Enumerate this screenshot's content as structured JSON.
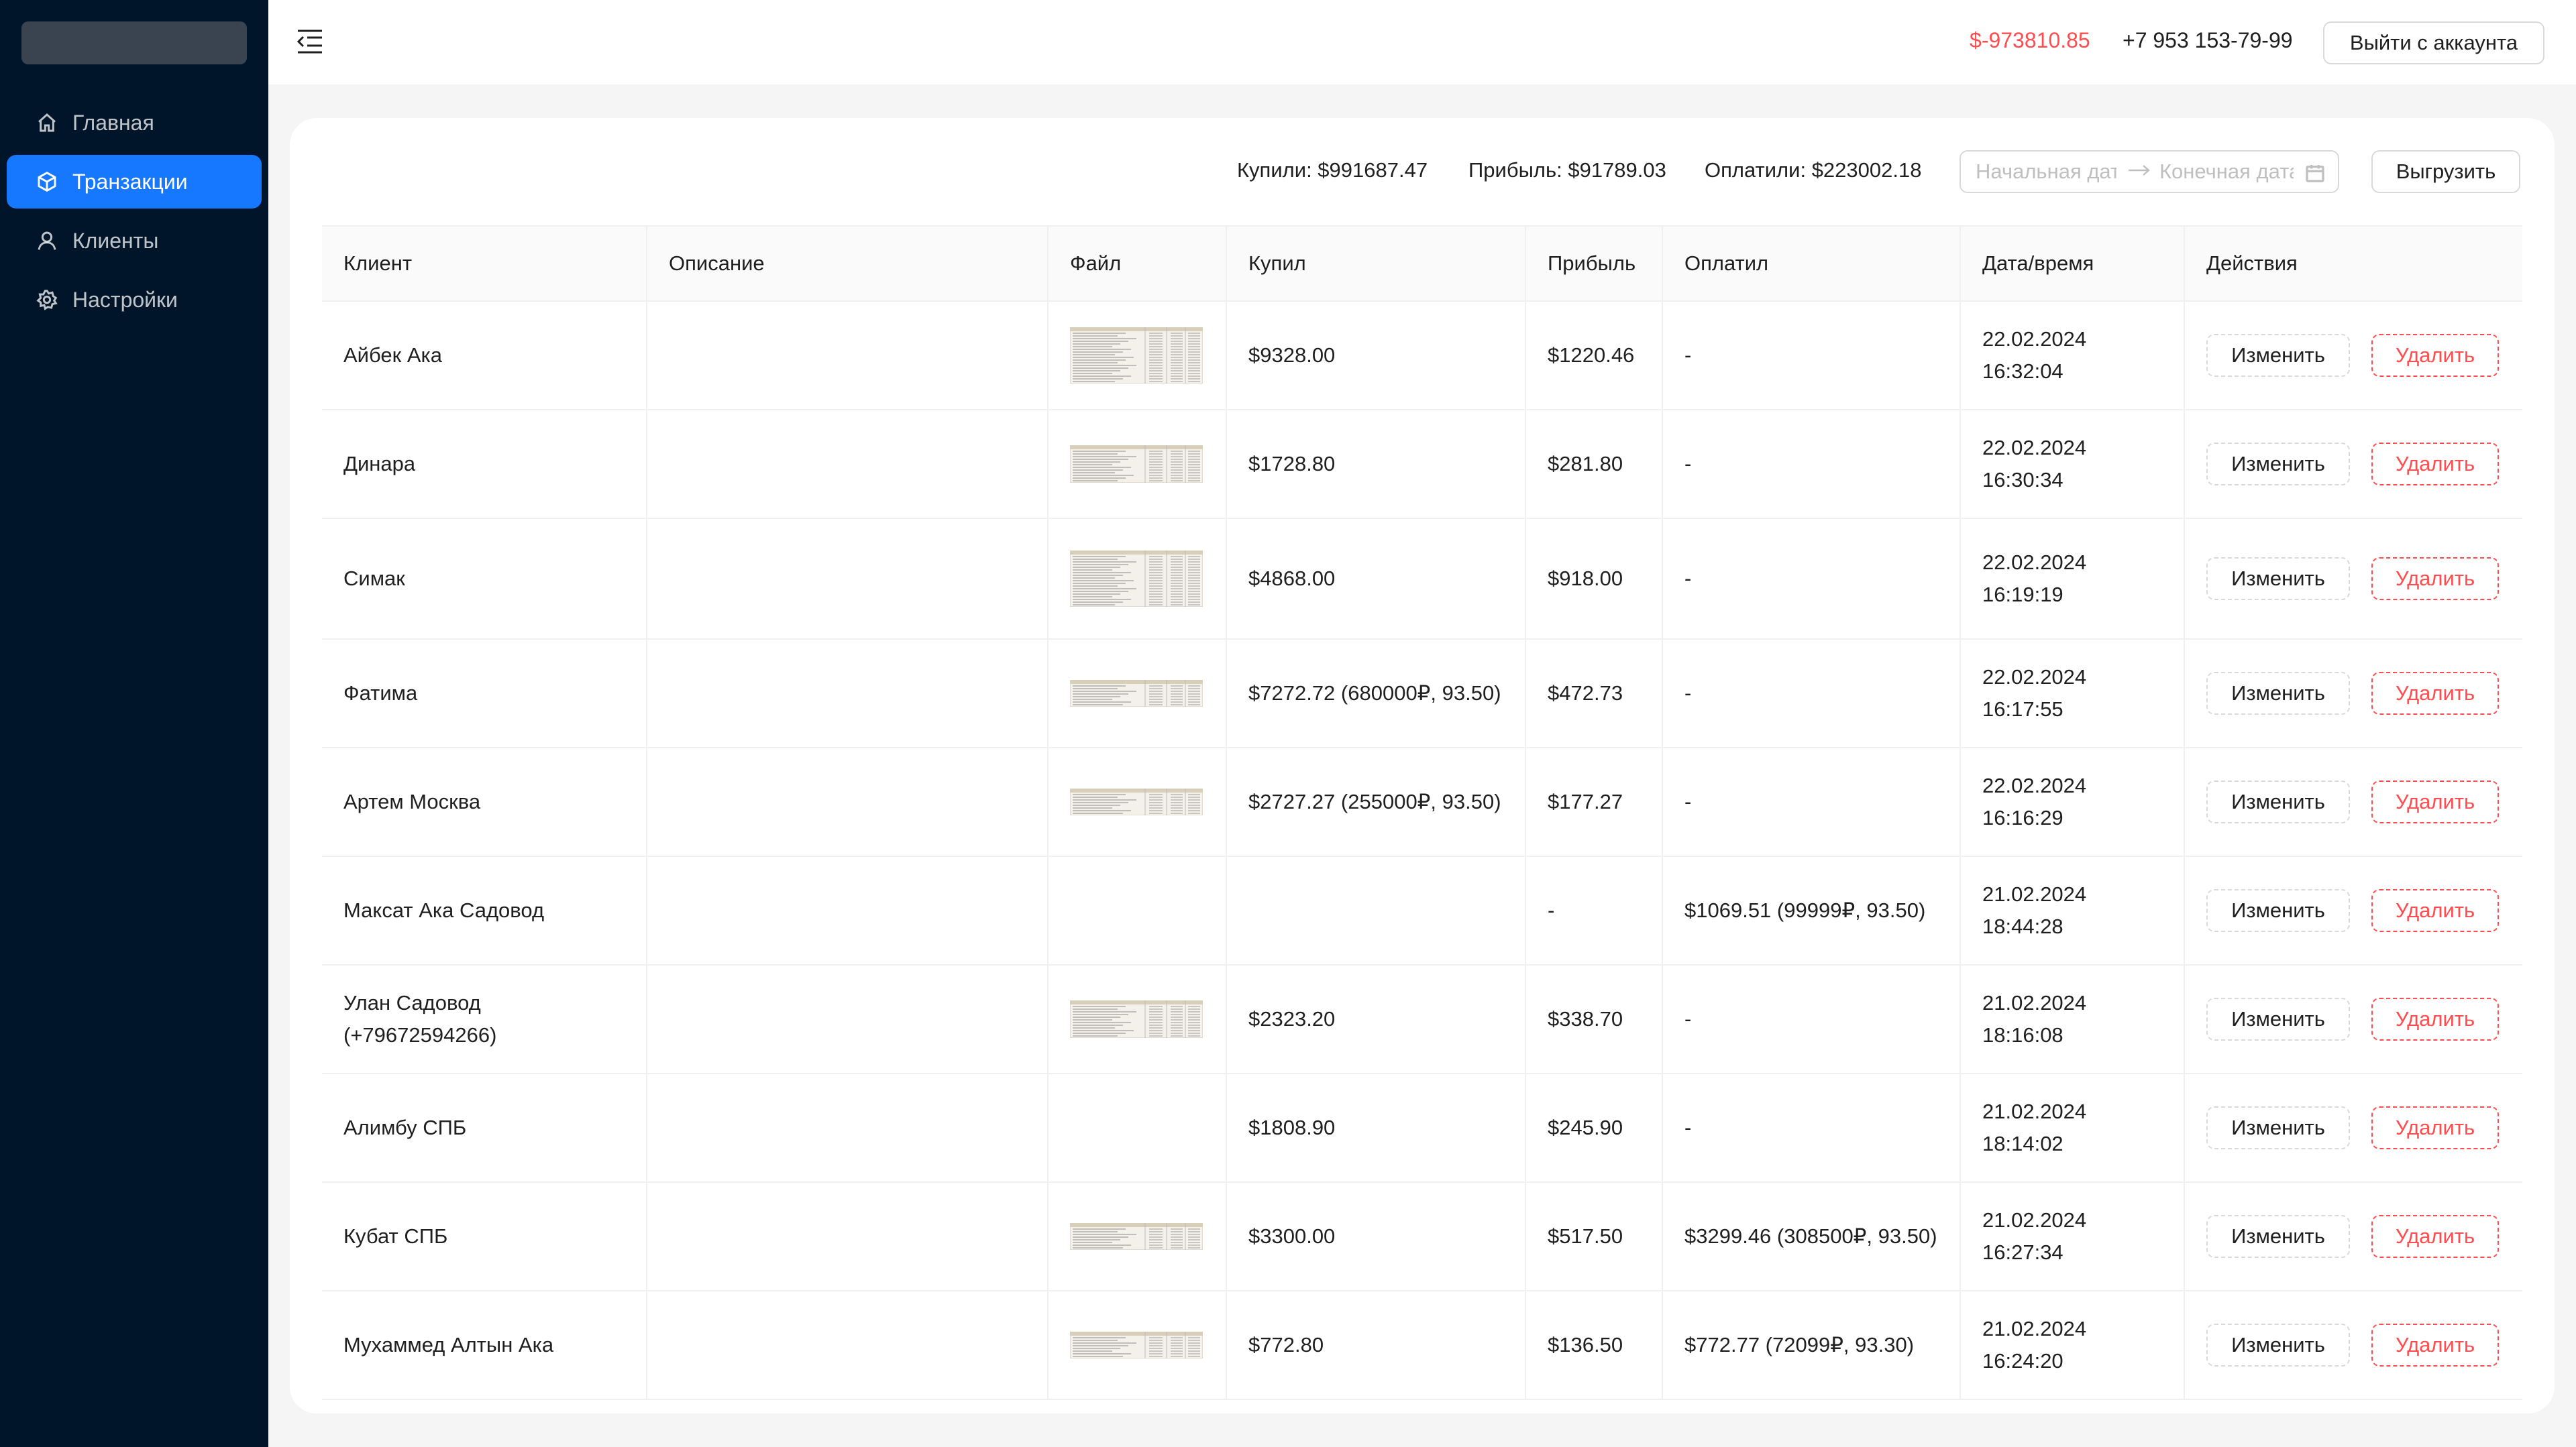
{
  "menu": [
    {
      "label": "Главная",
      "icon": "home-icon",
      "active": false
    },
    {
      "label": "Транзакции",
      "icon": "cube-icon",
      "active": true
    },
    {
      "label": "Клиенты",
      "icon": "user-icon",
      "active": false
    },
    {
      "label": "Настройки",
      "icon": "gear-icon",
      "active": false
    }
  ],
  "header": {
    "balance": "$-973810.85",
    "phone": "+7 953 153-79-99",
    "logout_label": "Выйти с аккаунта"
  },
  "summary": {
    "bought": "Купили: $991687.47",
    "profit": "Прибыль: $91789.03",
    "paid": "Оплатили: $223002.18"
  },
  "date_range": {
    "start_placeholder": "Начальная дата",
    "end_placeholder": "Конечная дата"
  },
  "export_label": "Выгрузить",
  "table": {
    "columns": [
      "Клиент",
      "Описание",
      "Файл",
      "Купил",
      "Прибыль",
      "Оплатил",
      "Дата/время",
      "Действия"
    ],
    "edit_label": "Изменить",
    "delete_label": "Удалить",
    "rows": [
      {
        "client": "Айбек Ака",
        "description": "",
        "file": "tall",
        "bought": "$9328.00",
        "profit": "$1220.46",
        "paid": "-",
        "date": "22.02.2024",
        "time": "16:32:04"
      },
      {
        "client": "Динара",
        "description": "",
        "file": "mid",
        "bought": "$1728.80",
        "profit": "$281.80",
        "paid": "-",
        "date": "22.02.2024",
        "time": "16:30:34"
      },
      {
        "client": "Симак",
        "description": "",
        "file": "tall",
        "bought": "$4868.00",
        "profit": "$918.00",
        "paid": "-",
        "date": "22.02.2024",
        "time": "16:19:19"
      },
      {
        "client": "Фатима",
        "description": "",
        "file": "short",
        "bought": "$7272.72 (680000₽, 93.50)",
        "profit": "$472.73",
        "paid": "-",
        "date": "22.02.2024",
        "time": "16:17:55"
      },
      {
        "client": "Артем Москва",
        "description": "",
        "file": "short",
        "bought": "$2727.27 (255000₽, 93.50)",
        "profit": "$177.27",
        "paid": "-",
        "date": "22.02.2024",
        "time": "16:16:29"
      },
      {
        "client": "Максат Ака Садовод",
        "description": "",
        "file": "",
        "bought": "",
        "profit": "-",
        "paid": "$1069.51 (99999₽, 93.50)",
        "date": "21.02.2024",
        "time": "18:44:28"
      },
      {
        "client": "Улан Садовод (+79672594266)",
        "description": "",
        "file": "mid",
        "bought": "$2323.20",
        "profit": "$338.70",
        "paid": "-",
        "date": "21.02.2024",
        "time": "18:16:08"
      },
      {
        "client": "Алимбу СПБ",
        "description": "",
        "file": "",
        "bought": "$1808.90",
        "profit": "$245.90",
        "paid": "-",
        "date": "21.02.2024",
        "time": "18:14:02"
      },
      {
        "client": "Кубат СПБ",
        "description": "",
        "file": "short",
        "bought": "$3300.00",
        "profit": "$517.50",
        "paid": "$3299.46 (308500₽, 93.50)",
        "date": "21.02.2024",
        "time": "16:27:34"
      },
      {
        "client": "Мухаммед Алтын Ака",
        "description": "",
        "file": "short",
        "bought": "$772.80",
        "profit": "$136.50",
        "paid": "$772.77 (72099₽, 93.30)",
        "date": "21.02.2024",
        "time": "16:24:20"
      }
    ]
  }
}
